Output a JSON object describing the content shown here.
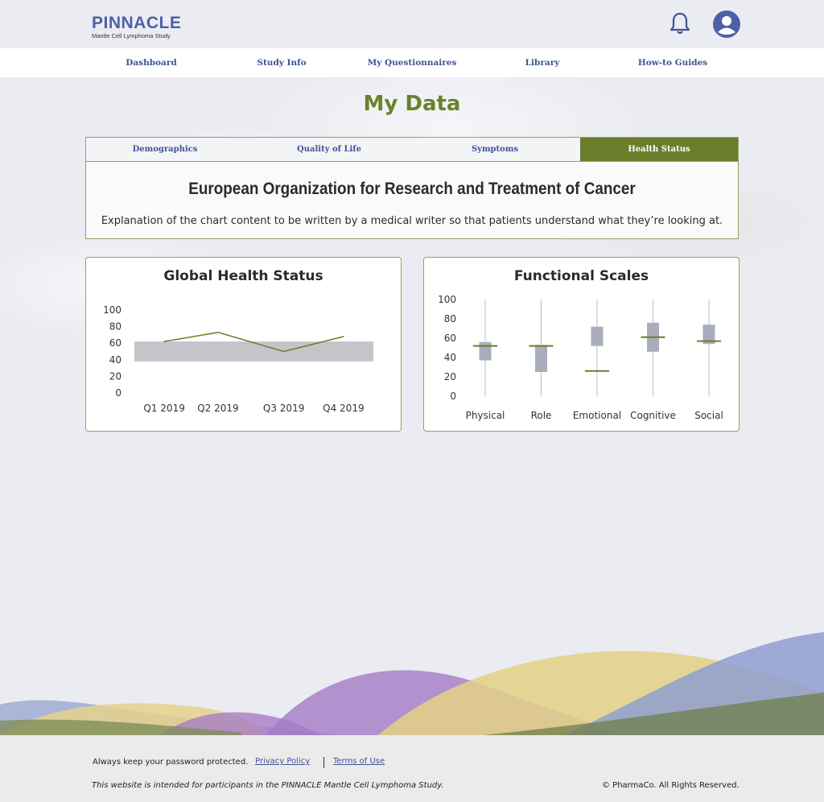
{
  "brand": {
    "name": "PINNACLE",
    "subtitle": "Mantle Cell Lymphoma Study"
  },
  "header_icons": {
    "notifications": "bell-icon",
    "profile": "user-avatar-icon"
  },
  "nav": {
    "items": [
      {
        "label": "Dashboard"
      },
      {
        "label": "Study Info"
      },
      {
        "label": "My Questionnaires"
      },
      {
        "label": "Library"
      },
      {
        "label": "How-to Guides"
      }
    ]
  },
  "page": {
    "title": "My Data"
  },
  "tabs": {
    "items": [
      {
        "label": "Demographics",
        "active": false
      },
      {
        "label": "Quality of Life",
        "active": false
      },
      {
        "label": "Symptoms",
        "active": false
      },
      {
        "label": "Health Status",
        "active": true
      }
    ]
  },
  "info": {
    "title": "European Organization for Research and Treatment of Cancer",
    "description": "Explanation of the chart content to be written by a medical writer so that patients understand what they’re looking at."
  },
  "colors": {
    "accent_green": "#6b7d2b",
    "nav_blue": "#3e5394",
    "brand_blue": "#4d5fa8",
    "band_gray": "#c3c5ca",
    "box_gray": "#a9adbc"
  },
  "chart_data": [
    {
      "type": "line",
      "title": "Global Health Status",
      "categories": [
        "Q1 2019",
        "Q2 2019",
        "Q3 2019",
        "Q4 2019"
      ],
      "x_positions": [
        0.5,
        1.4,
        2.5,
        3.5
      ],
      "series": [
        {
          "values": [
            62,
            73,
            50,
            68
          ]
        }
      ],
      "reference_band": [
        38,
        62
      ],
      "y_ticks": [
        0,
        20,
        40,
        60,
        80,
        100
      ],
      "ylim": [
        0,
        100
      ],
      "grid": false,
      "legend": "none"
    },
    {
      "type": "box",
      "title": "Functional Scales",
      "categories": [
        "Physical",
        "Role",
        "Emotional",
        "Cognitive",
        "Social"
      ],
      "boxes": [
        {
          "whisker_low": 0,
          "q1": 37,
          "q3": 56,
          "whisker_high": 100,
          "marker": 52
        },
        {
          "whisker_low": 0,
          "q1": 25,
          "q3": 53,
          "whisker_high": 100,
          "marker": 52
        },
        {
          "whisker_low": 0,
          "q1": 52,
          "q3": 72,
          "whisker_high": 100,
          "marker": 26
        },
        {
          "whisker_low": 0,
          "q1": 46,
          "q3": 76,
          "whisker_high": 100,
          "marker": 61
        },
        {
          "whisker_low": 0,
          "q1": 54,
          "q3": 74,
          "whisker_high": 100,
          "marker": 57
        }
      ],
      "y_ticks": [
        0,
        20,
        40,
        60,
        80,
        100
      ],
      "ylim": [
        0,
        100
      ],
      "grid": false,
      "legend": "none"
    }
  ],
  "footer": {
    "password_note": "Always keep your password protected.",
    "privacy_link": "Privacy Policy",
    "terms_link": "Terms of Use",
    "disclaimer": "This website is intended for participants in the PINNACLE Mantle Cell Lymphoma Study.",
    "copyright": "© PharmaCo. All Rights Reserved."
  }
}
